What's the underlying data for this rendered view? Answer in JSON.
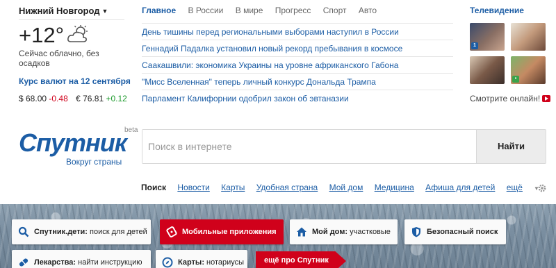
{
  "location": {
    "city": "Нижний Новгород"
  },
  "weather": {
    "temperature": "+12°",
    "description": "Сейчас облачно, без осадков",
    "icon": "partly-cloudy-icon"
  },
  "rates": {
    "title": "Курс валют на 12 сентября",
    "usd_value": "$ 68.00",
    "usd_change": "-0.48",
    "eur_value": "€ 76.81",
    "eur_change": "+0.12"
  },
  "news": {
    "tabs": [
      "Главное",
      "В России",
      "В мире",
      "Прогресс",
      "Спорт",
      "Авто"
    ],
    "active_tab": "Главное",
    "items": [
      "День тишины перед региональными выборами наступил в России",
      "Геннадий Падалка установил новый рекорд пребывания в космосе",
      "Саакашвили: экономика Украины на уровне африканского Габона",
      "\"Мисс Вселенная\" теперь личный конкурс Дональда Трампа",
      "Парламент Калифорнии одобрил закон об эвтаназии"
    ]
  },
  "tv": {
    "title": "Телевидение",
    "watch_label": "Смотрите онлайн!"
  },
  "logo": {
    "name": "Спутник",
    "badge": "beta",
    "tagline": "Вокруг страны"
  },
  "search": {
    "placeholder": "Поиск в интернете",
    "button": "Найти"
  },
  "services": {
    "current": "Поиск",
    "items": [
      "Новости",
      "Карты",
      "Удобная страна",
      "Мой дом",
      "Медицина",
      "Афиша для детей"
    ],
    "more": "ещё"
  },
  "tiles": {
    "kids": {
      "bold": "Спутник.дети:",
      "rest": " поиск для детей"
    },
    "apps": {
      "bold": "Мобильные приложения",
      "rest": ""
    },
    "home": {
      "bold": "Мой дом:",
      "rest": " участковые"
    },
    "safe": {
      "bold": "Безопасный поиск",
      "rest": ""
    },
    "meds": {
      "bold": "Лекарства:",
      "rest": " найти инструкцию"
    },
    "maps": {
      "bold": "Карты:",
      "rest": " нотариусы"
    },
    "more_about": "ещё про Спутник"
  },
  "colors": {
    "brand": "#1c5da5",
    "accent": "#d0011b",
    "negative": "#d0011b",
    "positive": "#1c9a2c"
  }
}
